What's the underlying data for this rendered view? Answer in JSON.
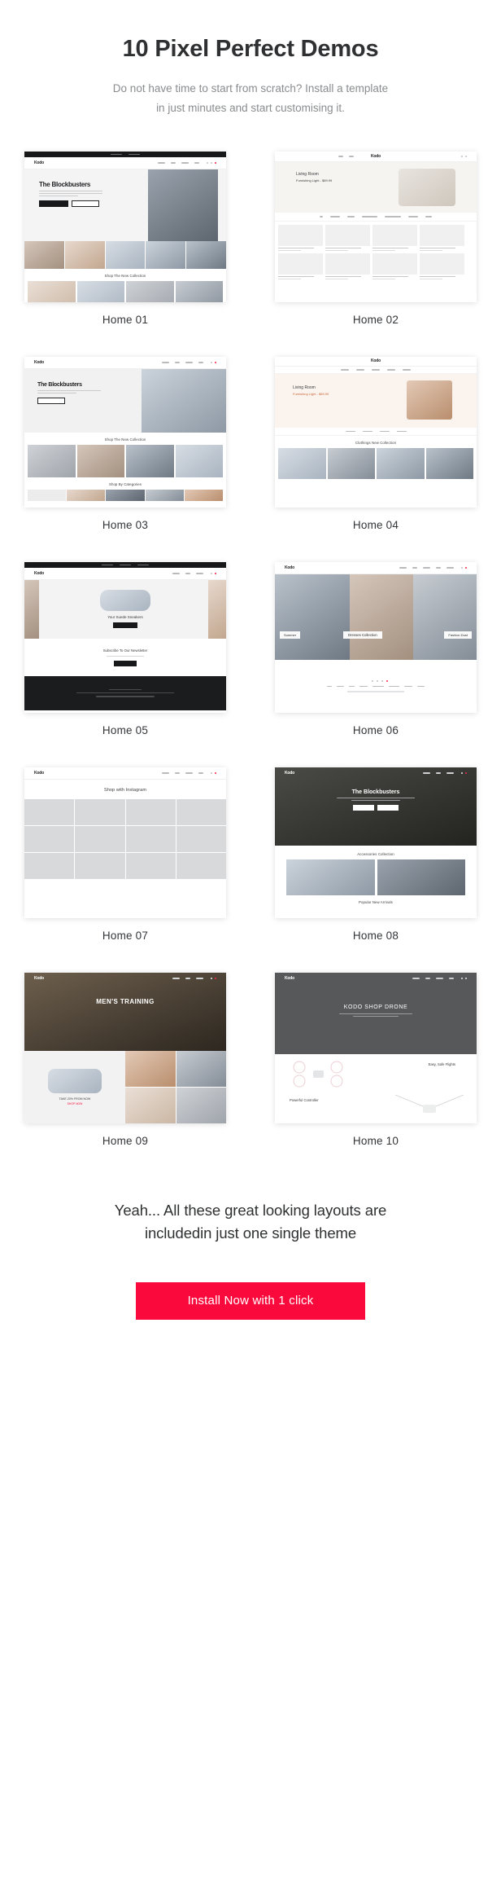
{
  "hero": {
    "title": "10 Pixel Perfect Demos",
    "subtitle_line1": "Do not have time to start from scratch? Install a template",
    "subtitle_line2": "in just minutes and start customising it."
  },
  "brand": "Kodo",
  "demos": [
    {
      "id": "home-01",
      "caption": "Home 01",
      "heading": "The Blockbusters",
      "section_title": "Shop The New Collection",
      "buttons": [
        "SHOP THE LOOK",
        "VIEW MORE"
      ]
    },
    {
      "id": "home-02",
      "caption": "Home 02",
      "heading": "Living Room",
      "subheading": "Furnishing Light - $89.99",
      "categories": [
        "All",
        "Furniture",
        "Decor",
        "Plants & Greens",
        "Arts & Tapestries",
        "Candles",
        "Rugs"
      ],
      "filter_label": "Filter",
      "product_label": "Example: get one chair",
      "product_price": "$19.00"
    },
    {
      "id": "home-03",
      "caption": "Home 03",
      "heading": "The Blockbusters",
      "section_title": "Shop The New Collection",
      "section_title2": "Shop By Categories",
      "buttons": [
        "SHOP NOW"
      ]
    },
    {
      "id": "home-04",
      "caption": "Home 04",
      "heading": "Living Room",
      "subheading": "Furnishing Light - $89.99",
      "section_title": "Clothings New Collection"
    },
    {
      "id": "home-05",
      "caption": "Home 05",
      "heading": "Your Suede Sneakers",
      "button": "SHOP NOW",
      "newsletter_title": "Subscribe To Our Newsletter",
      "newsletter_button": "SUBSCRIBE",
      "copyright": "© 2019 Kodo. All rights reserved."
    },
    {
      "id": "home-06",
      "caption": "Home 06",
      "tiles": [
        "Summer",
        "Dresses Collection",
        "Fashion Dust"
      ],
      "footer_links": [
        "Kodo",
        "About",
        "Blog",
        "Contact",
        "Returns Policy",
        "Privacy Policy",
        "Gift Card",
        "Sitemap"
      ]
    },
    {
      "id": "home-07",
      "caption": "Home 07",
      "heading": "Shop with Instagram"
    },
    {
      "id": "home-08",
      "caption": "Home 08",
      "heading": "The Blockbusters",
      "buttons": [
        "SHOP THE LOOK",
        "VIEW MORE"
      ],
      "section_title": "Accessories Collection",
      "section_title2": "Popular New Arrivals"
    },
    {
      "id": "home-09",
      "caption": "Home 09",
      "heading": "MEN'S TRAINING",
      "badge": "TAKE 20% FROM NOW",
      "badge_sub": "SHOP NOW"
    },
    {
      "id": "home-10",
      "caption": "Home 10",
      "heading": "KODO SHOP DRONE",
      "feature1": "Easy, Safe Flights",
      "feature2": "Powerful Controller"
    }
  ],
  "cta": {
    "line1": "Yeah... All these great looking layouts are",
    "line2": "includedin just one single theme",
    "button_label": "Install Now with 1 click",
    "button_color": "#fa0a3c"
  }
}
